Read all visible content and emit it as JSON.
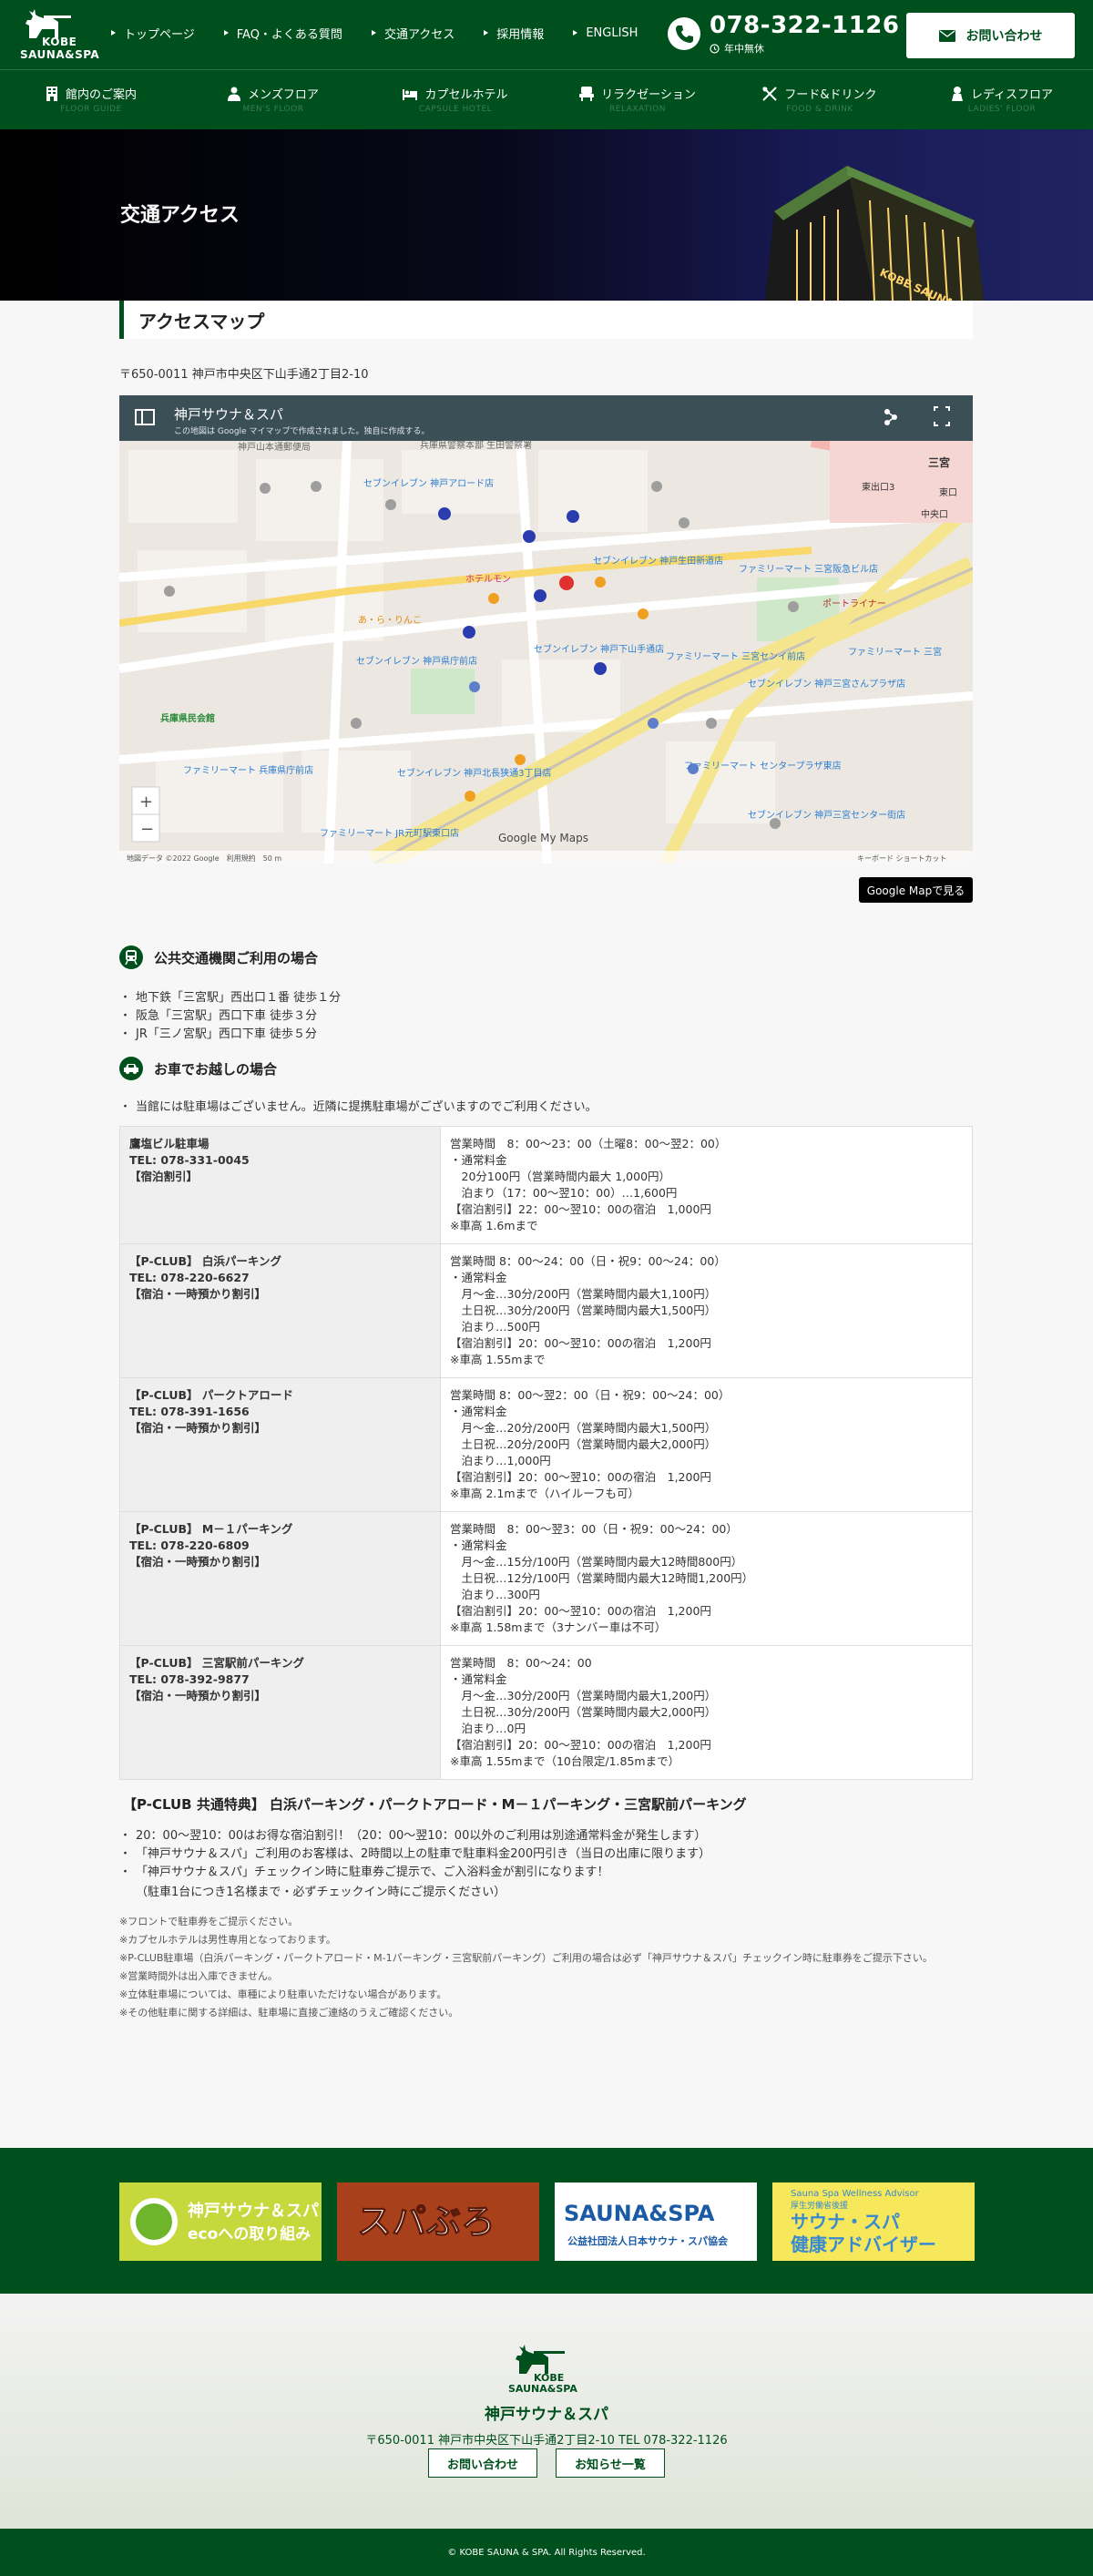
{
  "header": {
    "logo_line1": "KOBE",
    "logo_line2": "SAUNA&SPA",
    "nav": [
      {
        "label": "トップページ"
      },
      {
        "label": "FAQ・よくある質問"
      },
      {
        "label": "交通アクセス"
      },
      {
        "label": "採用情報"
      },
      {
        "label": "ENGLISH"
      }
    ],
    "phone": "078-322-1126",
    "phone_note": "年中無休",
    "contact_label": "お問い合わせ"
  },
  "main_nav": [
    {
      "label": "館内のご案内",
      "en": "FLOOR GUIDE",
      "icon": "building-icon"
    },
    {
      "label": "メンズフロア",
      "en": "MEN'S FLOOR",
      "icon": "man-icon"
    },
    {
      "label": "カプセルホテル",
      "en": "CAPSULE HOTEL",
      "icon": "bed-icon"
    },
    {
      "label": "リラクゼーション",
      "en": "RELAXATION",
      "icon": "chair-icon"
    },
    {
      "label": "フード&ドリンク",
      "en": "FOOD & DRINK",
      "icon": "utensils-icon"
    },
    {
      "label": "レディスフロア",
      "en": "LADIES' FLOOR",
      "icon": "woman-icon"
    }
  ],
  "hero": {
    "title": "交通アクセス",
    "sign": "KOBE SAUNA&SPA"
  },
  "access": {
    "section_title": "アクセスマップ",
    "address": "〒650-0011 神戸市中央区下山手通2丁目2-10",
    "map": {
      "title": "神戸サウナ＆スパ",
      "subtitle": "この地図は Google マイマップで作成されました。独自に作成する。",
      "footer": "地図データ ©2022 Google　利用規約　50 m",
      "brand": "Google My Maps",
      "shortcut": "キーボード ショートカット",
      "labels": [
        {
          "text": "神戸山本通郵便局"
        },
        {
          "text": "兵庫県警察本部 生田警察署"
        },
        {
          "text": "セブンイレブン 神戸アロード店"
        },
        {
          "text": "ホテルモン"
        },
        {
          "text": "セブンイレブン 神戸生田新道店"
        },
        {
          "text": "ファミリーマート 三宮阪急ビル店"
        },
        {
          "text": "あ・ら・りんこ"
        },
        {
          "text": "セブンイレブン 神戸下山手通店"
        },
        {
          "text": "セブンイレブン 神戸県庁前店"
        },
        {
          "text": "ファミリーマート 三宮センイ前店"
        },
        {
          "text": "ファミリーマート 三宮"
        },
        {
          "text": "セブンイレブン 神戸三宮さんプラザ店"
        },
        {
          "text": "兵庫県民会館"
        },
        {
          "text": "ファミリーマート 兵庫県庁前店"
        },
        {
          "text": "セブンイレブン 神戸北長狭通3丁目店"
        },
        {
          "text": "ファミリーマート センタープラザ東店"
        },
        {
          "text": "ファミリーマート JR元町駅東口店"
        },
        {
          "text": "セブンイレブン 神戸三宮センター街店"
        },
        {
          "text": "三宮"
        },
        {
          "text": "東出口3"
        },
        {
          "text": "中央口"
        },
        {
          "text": "東口"
        },
        {
          "text": "ポートライナー"
        }
      ]
    },
    "gmap_button": "Google Mapで見る"
  },
  "transit": {
    "title": "公共交通機関ご利用の場合",
    "items": [
      "地下鉄「三宮駅」西出口１番 徒歩１分",
      "阪急「三宮駅」西口下車 徒歩３分",
      "JR「三ノ宮駅」西口下車 徒歩５分"
    ]
  },
  "car": {
    "title": "お車でお越しの場合",
    "note": "当館には駐車場はございません。近隣に提携駐車場がございますのでご利用ください。",
    "parking": [
      {
        "left": [
          "鷹塩ビル駐車場",
          "TEL: 078-331-0045",
          "【宿泊割引】"
        ],
        "right": [
          "営業時間　8：00～23：00（土曜8：00～翌2：00）",
          "・通常料金",
          "　20分100円（営業時間内最大 1,000円）",
          "　泊まり（17：00～翌10：00）…1,600円",
          "【宿泊割引】22：00～翌10：00の宿泊　1,000円",
          "※車高 1.6mまで"
        ]
      },
      {
        "left": [
          "【P-CLUB】 白浜パーキング",
          "TEL: 078-220-6627",
          "【宿泊・一時預かり割引】"
        ],
        "right": [
          "営業時間 8：00～24：00（日・祝9：00～24：00）",
          "・通常料金",
          "　月～金…30分/200円（営業時間内最大1,100円）",
          "　土日祝…30分/200円（営業時間内最大1,500円）",
          "　泊まり…500円",
          "【宿泊割引】20：00～翌10：00の宿泊　1,200円",
          "※車高 1.55mまで"
        ]
      },
      {
        "left": [
          "【P-CLUB】 パークトアロード",
          "TEL: 078-391-1656",
          "【宿泊・一時預かり割引】"
        ],
        "right": [
          "営業時間 8：00～翌2：00（日・祝9：00～24：00）",
          "・通常料金",
          "　月～金…20分/200円（営業時間内最大1,500円）",
          "　土日祝…20分/200円（営業時間内最大2,000円）",
          "　泊まり…1,000円",
          "【宿泊割引】20：00～翌10：00の宿泊　1,200円",
          "※車高 2.1mまで（ハイルーフも可）"
        ]
      },
      {
        "left": [
          "【P-CLUB】 M－１パーキング",
          "TEL: 078-220-6809",
          "【宿泊・一時預かり割引】"
        ],
        "right": [
          "営業時間　8：00～翌3：00（日・祝9：00～24：00）",
          "・通常料金",
          "　月～金…15分/100円（営業時間内最大12時間800円）",
          "　土日祝…12分/100円（営業時間内最大12時間1,200円）",
          "　泊まり…300円",
          "【宿泊割引】20：00～翌10：00の宿泊　1,200円",
          "※車高 1.58mまで（3ナンバー車は不可）"
        ]
      },
      {
        "left": [
          "【P-CLUB】 三宮駅前パーキング",
          "TEL: 078-392-9877",
          "【宿泊・一時預かり割引】"
        ],
        "right": [
          "営業時間　8：00～24：00",
          "・通常料金",
          "　月～金…30分/200円（営業時間内最大1,200円）",
          "　土日祝…30分/200円（営業時間内最大2,000円）",
          "　泊まり…0円",
          "【宿泊割引】20：00～翌10：00の宿泊　1,200円",
          "※車高 1.55mまで（10台限定/1.85mまで）"
        ]
      }
    ],
    "benefit_title": "【P-CLUB 共通特典】 白浜パーキング・パークトアロード・M－１パーキング・三宮駅前パーキング",
    "benefit_items": [
      "20：00～翌10：00はお得な宿泊割引！（20：00～翌10：00以外のご利用は別途通常料金が発生します）",
      "「神戸サウナ＆スパ」ご利用のお客様は、2時間以上の駐車で駐車料金200円引き（当日の出庫に限ります）",
      "「神戸サウナ＆スパ」チェックイン時に駐車券ご提示で、ご入浴料金が割引になります！"
    ],
    "benefit_sub": "（駐車1台につき1名様まで・必ずチェックイン時にご提示ください）",
    "notes": [
      "※フロントで駐車券をご提示ください。",
      "※カプセルホテルは男性専用となっております。",
      "※P-CLUB駐車場（白浜パーキング・パークトアロード・M-1パーキング・三宮駅前パーキング）ご利用の場合は必ず「神戸サウナ＆スパ」チェックイン時に駐車券をご提示下さい。",
      "※営業時間外は出入庫できません。",
      "※立体駐車場については、車種により駐車いただけない場合があります。",
      "※その他駐車に関する詳細は、駐車場に直接ご連絡のうえご確認ください。"
    ]
  },
  "banners": [
    {
      "title": "神戸サウナ＆スパ",
      "sub": "ecoへの取り組み"
    },
    {
      "title": "スパぶろ"
    },
    {
      "title": "SAUNA&SPA",
      "sub": "公益社団法人日本サウナ・スパ協会"
    },
    {
      "title": "Sauna Spa Wellness Advisor",
      "sub1": "厚生労働省後援",
      "sub2": "サウナ・スパ",
      "sub3": "健康アドバイザー"
    }
  ],
  "footer": {
    "logo_line1": "KOBE",
    "logo_line2": "SAUNA&SPA",
    "name": "神戸サウナ＆スパ",
    "address": "〒650-0011 神戸市中央区下山手通2丁目2-10 TEL 078-322-1126",
    "btn_contact": "お問い合わせ",
    "btn_news": "お知らせ一覧",
    "copyright": "© KOBE SAUNA & SPA. All Rights Reserved."
  },
  "colors": {
    "brand_green": "#00501e",
    "map_bar": "#3b4f57"
  }
}
